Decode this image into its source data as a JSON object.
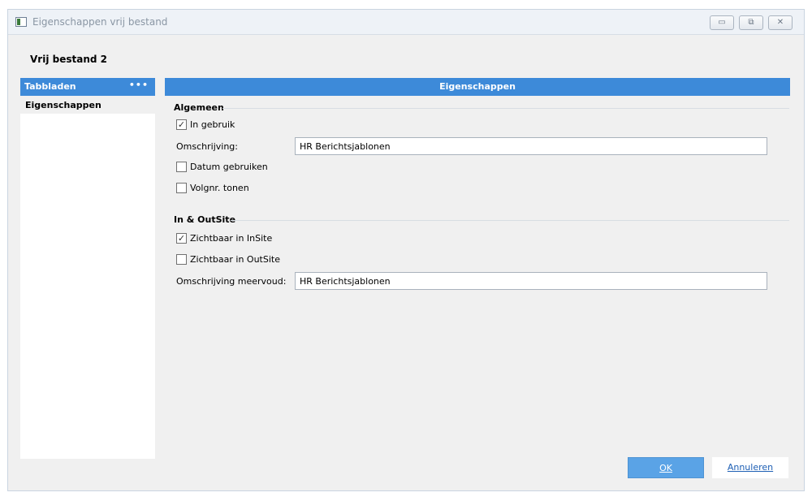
{
  "window": {
    "title": "Eigenschappen vrij bestand",
    "minimize_glyph": "▭",
    "restore_glyph": "⧉",
    "close_glyph": "✕"
  },
  "heading": "Vrij bestand 2",
  "tabs": {
    "header": "Tabbladen",
    "menu_glyph": "•••",
    "items": [
      {
        "label": "Eigenschappen",
        "selected": true
      }
    ]
  },
  "content": {
    "header": "Eigenschappen",
    "algemeen": {
      "title": "Algemeen",
      "in_gebruik": {
        "label": "In gebruik",
        "checked": true
      },
      "omschrijving": {
        "label": "Omschrijving:",
        "value": "HR Berichtsjablonen"
      },
      "datum_gebruiken": {
        "label": "Datum gebruiken",
        "checked": false
      },
      "volgnr_tonen": {
        "label": "Volgnr. tonen",
        "checked": false
      }
    },
    "inoutsite": {
      "title": "In & OutSite",
      "zichtbaar_insite": {
        "label": "Zichtbaar in InSite",
        "checked": true
      },
      "zichtbaar_outsite": {
        "label": "Zichtbaar in OutSite",
        "checked": false
      },
      "omschrijving_meervoud": {
        "label": "Omschrijving meervoud:",
        "value": "HR Berichtsjablonen"
      }
    }
  },
  "buttons": {
    "ok": "OK",
    "cancel": "Annuleren"
  },
  "colors": {
    "accent": "#3d8ad9",
    "ok_button": "#5aa3e6",
    "cancel_text": "#1e5fb4"
  }
}
